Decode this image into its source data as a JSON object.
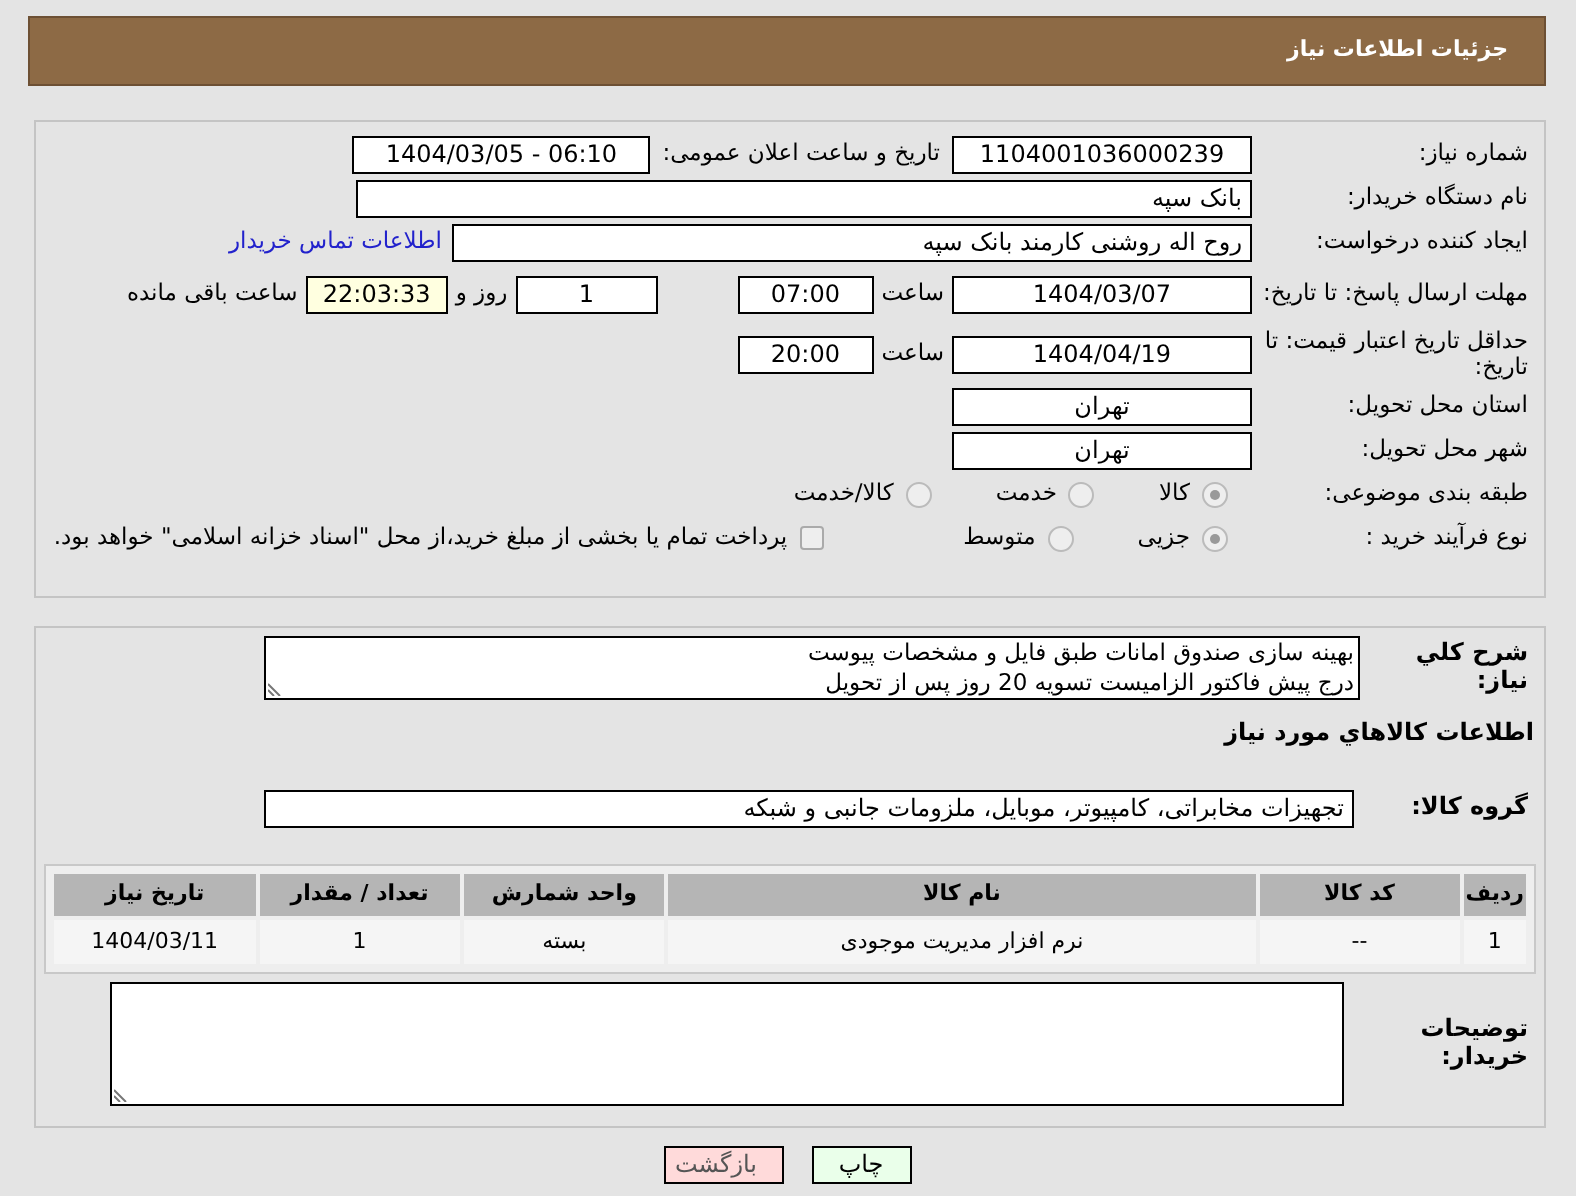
{
  "header": {
    "title": "جزئیات اطلاعات نیاز"
  },
  "rows": [
    {
      "label": "شماره نیاز:",
      "controls": [
        {
          "kind": "field",
          "value": "1104001036000239"
        },
        {
          "kind": "text",
          "text": "تاریخ و ساعت اعلان عمومی:"
        },
        {
          "kind": "field",
          "value": "1404/03/05 - 06:10"
        }
      ]
    },
    {
      "label": "نام دستگاه خریدار:",
      "controls": [
        {
          "kind": "field",
          "value": "بانک سپه"
        }
      ]
    },
    {
      "label": "ایجاد کننده درخواست:",
      "controls": [
        {
          "kind": "field",
          "value": "روح اله روشنی کارمند بانک سپه"
        },
        {
          "kind": "link",
          "text": "اطلاعات تماس خریدار"
        }
      ]
    },
    {
      "label": "مهلت ارسال پاسخ: تا تاریخ:",
      "controls": [
        {
          "kind": "field",
          "value": "1404/03/07"
        },
        {
          "kind": "text",
          "text": "ساعت"
        },
        {
          "kind": "field",
          "value": "07:00"
        },
        {
          "kind": "field",
          "value": "1"
        },
        {
          "kind": "text",
          "text": "روز و"
        },
        {
          "kind": "timer",
          "value": "22:03:33"
        },
        {
          "kind": "text",
          "text": "ساعت باقی مانده"
        }
      ]
    },
    {
      "label": "حداقل تاریخ اعتبار قیمت: تا تاریخ:",
      "controls": [
        {
          "kind": "field",
          "value": "1404/04/19"
        },
        {
          "kind": "text",
          "text": "ساعت"
        },
        {
          "kind": "field",
          "value": "20:00"
        }
      ]
    },
    {
      "label": "استان محل تحویل:",
      "controls": [
        {
          "kind": "field",
          "value": "تهران"
        }
      ]
    },
    {
      "label": "شهر محل تحویل:",
      "controls": [
        {
          "kind": "field",
          "value": "تهران"
        }
      ]
    },
    {
      "label": "طبقه بندی موضوعی:",
      "controls": [
        {
          "kind": "radio",
          "label": "کالا",
          "selected": true
        },
        {
          "kind": "radio",
          "label": "خدمت",
          "selected": false
        },
        {
          "kind": "radio",
          "label": "کالا/خدمت",
          "selected": false
        }
      ]
    },
    {
      "label": "نوع فرآیند خرید :",
      "controls": [
        {
          "kind": "radio",
          "label": "جزیی",
          "selected": true
        },
        {
          "kind": "radio",
          "label": "متوسط",
          "selected": false
        },
        {
          "kind": "checkbox",
          "label": "پرداخت تمام یا بخشی از مبلغ خرید،از محل \"اسناد خزانه اسلامی\" خواهد بود.",
          "checked": false
        }
      ]
    }
  ],
  "description": {
    "label": "شرح کلي نياز:",
    "lines": [
      "بهینه سازی صندوق امانات طبق فایل و مشخصات پیوست",
      "درج پیش فاکتور الزامیست  تسویه 20 روز پس از تحویل"
    ]
  },
  "goods_title": "اطلاعات کالاهاي مورد نياز",
  "goods_group": {
    "label": "گروه کالا:",
    "value": "تجهیزات مخابراتی، کامپیوتر، موبایل، ملزومات جانبی و شبکه"
  },
  "table": {
    "columns": [
      "ردیف",
      "کد کالا",
      "نام کالا",
      "واحد شمارش",
      "تعداد / مقدار",
      "تاریخ نیاز"
    ],
    "rows": [
      [
        "1",
        "--",
        "نرم افزار مدیریت موجودی",
        "بسته",
        "1",
        "1404/03/11"
      ]
    ]
  },
  "buyer_notes": {
    "label": "توضیحات خریدار:"
  },
  "buttons": [
    {
      "kind": "print",
      "label": "چاپ"
    },
    {
      "kind": "back",
      "label": "بازگشت"
    }
  ]
}
